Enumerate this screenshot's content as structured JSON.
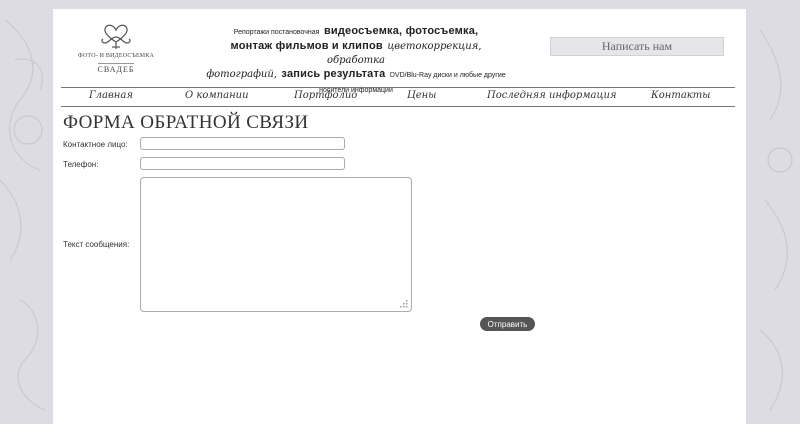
{
  "logo": {
    "line1": "ФОТО- И ВИДЕОСЪЕМКА",
    "line2": "СВАДЕБ"
  },
  "tagline": {
    "part1": "Репортажи постановочная",
    "part2": "видеосъемка, фотосъемка,",
    "part3": "монтаж фильмов и клипов",
    "part4": "цветокоррекция, обработка",
    "part5": "фотографий,",
    "part6": "запись результата",
    "part7": "DVD/Blu-Ray диски и любые другие",
    "part8": "носители информации"
  },
  "header": {
    "write_button": "Написать нам"
  },
  "nav": {
    "items": [
      {
        "label": "Главная"
      },
      {
        "label": "О компании"
      },
      {
        "label": "Портфолио"
      },
      {
        "label": "Цены"
      },
      {
        "label": "Последняя информация"
      },
      {
        "label": "Контакты"
      }
    ]
  },
  "form": {
    "title": "ФОРМА ОБРАТНОЙ СВЯЗИ",
    "contact_label": "Контактное лицо:",
    "contact_value": "",
    "phone_label": "Телефон:",
    "phone_value": "",
    "message_label": "Текст сообщения:",
    "message_value": "",
    "submit_label": "Отправить"
  },
  "colors": {
    "background": "#dcdce2",
    "page": "#ffffff",
    "button_dark": "#555555",
    "button_light": "#e6e6ea"
  }
}
